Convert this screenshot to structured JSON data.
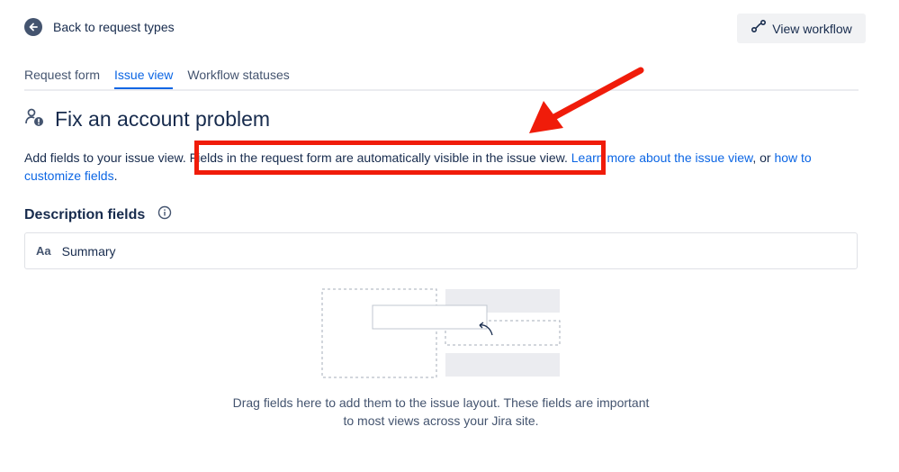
{
  "back_link": {
    "label": "Back to request types",
    "icon": "arrow-left-icon"
  },
  "view_workflow": {
    "label": "View workflow",
    "icon": "workflow-icon"
  },
  "tabs": [
    {
      "label": "Request form",
      "active": false
    },
    {
      "label": "Issue view",
      "active": true
    },
    {
      "label": "Workflow statuses",
      "active": false
    }
  ],
  "heading": {
    "title": "Fix an account problem",
    "icon": "user-alert-icon"
  },
  "description": {
    "intro": "Add fields to your issue view.",
    "highlighted": "Fields in the request form are automatically visible in the issue view.",
    "link1": "Learn more about the issue view",
    "mid": ", or ",
    "link2": "how to customize fields",
    "end": "."
  },
  "section": {
    "title": "Description fields",
    "info_icon": "info-icon"
  },
  "fields": [
    {
      "icon_text": "Aa",
      "label": "Summary"
    }
  ],
  "empty_state": {
    "line1": "Drag fields here to add them to the issue layout. These fields are important",
    "line2": "to most views across your Jira site."
  },
  "colors": {
    "annotation": "#f01c0a",
    "link": "#0c66e4",
    "text": "#172b4d"
  }
}
